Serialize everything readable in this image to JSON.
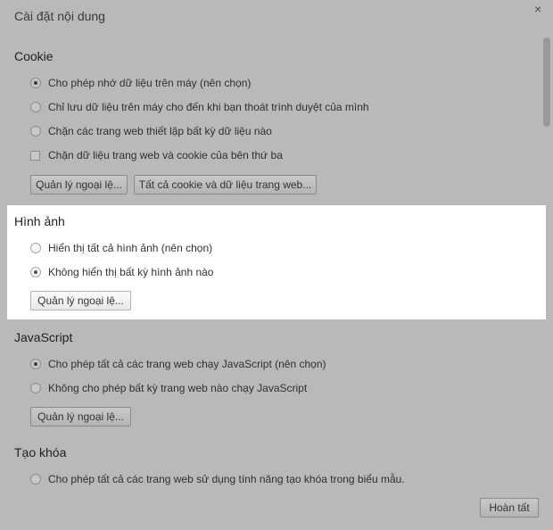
{
  "dialog": {
    "title": "Cài đặt nội dung",
    "close_glyph": "×",
    "done_label": "Hoàn tất"
  },
  "cookie": {
    "heading": "Cookie",
    "options": [
      {
        "label": "Cho phép nhớ dữ liệu trên máy (nên chọn)",
        "selected": true
      },
      {
        "label": "Chỉ lưu dữ liệu trên máy cho đến khi bạn thoát trình duyệt của mình",
        "selected": false
      },
      {
        "label": "Chặn các trang web thiết lập bất kỳ dữ liệu nào",
        "selected": false
      }
    ],
    "block_third_party_label": "Chặn dữ liệu trang web và cookie của bên thứ ba",
    "manage_exceptions_label": "Quản lý ngoại lệ...",
    "all_cookies_label": "Tất cả cookie và dữ liệu trang web..."
  },
  "images": {
    "heading": "Hình ảnh",
    "options": [
      {
        "label": "Hiển thị tất cả hình ảnh (nên chọn)",
        "selected": false
      },
      {
        "label": "Không hiển thị bất kỳ hình ảnh nào",
        "selected": true
      }
    ],
    "manage_exceptions_label": "Quản lý ngoại lệ..."
  },
  "javascript": {
    "heading": "JavaScript",
    "options": [
      {
        "label": "Cho phép tất cả các trang web chạy JavaScript (nên chọn)",
        "selected": true
      },
      {
        "label": "Không cho phép bất kỳ trang web nào chạy JavaScript",
        "selected": false
      }
    ],
    "manage_exceptions_label": "Quản lý ngoại lệ..."
  },
  "keygen": {
    "heading": "Tạo khóa",
    "options": [
      {
        "label": "Cho phép tất cả các trang web sử dụng tính năng tạo khóa trong biểu mẫu.",
        "selected": false
      }
    ]
  }
}
